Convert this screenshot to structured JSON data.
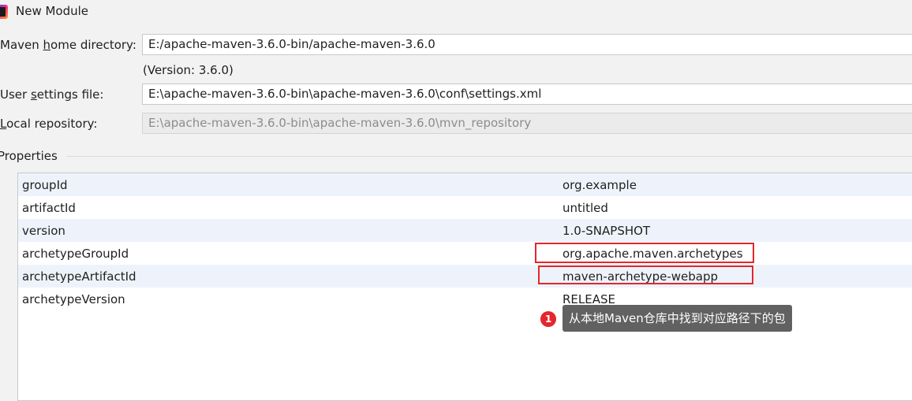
{
  "window": {
    "title": "New Module",
    "icon": "intellij-app-icon"
  },
  "form": {
    "maven_home": {
      "label_pre": "Maven ",
      "label_mnemonic": "h",
      "label_post": "ome directory:",
      "value": "E:/apache-maven-3.6.0-bin/apache-maven-3.6.0"
    },
    "version_note": "(Version: 3.6.0)",
    "user_settings": {
      "label_pre": "User ",
      "label_mnemonic": "s",
      "label_post": "ettings file:",
      "value": "E:\\apache-maven-3.6.0-bin\\apache-maven-3.6.0\\conf\\settings.xml"
    },
    "local_repo": {
      "label_pre": "",
      "label_mnemonic": "L",
      "label_post": "ocal repository:",
      "value": "E:\\apache-maven-3.6.0-bin\\apache-maven-3.6.0\\mvn_repository"
    }
  },
  "properties": {
    "section_label": "Properties",
    "rows": [
      {
        "key": "groupId",
        "value": "org.example"
      },
      {
        "key": "artifactId",
        "value": "untitled"
      },
      {
        "key": "version",
        "value": "1.0-SNAPSHOT"
      },
      {
        "key": "archetypeGroupId",
        "value": "org.apache.maven.archetypes"
      },
      {
        "key": "archetypeArtifactId",
        "value": "maven-archetype-webapp"
      },
      {
        "key": "archetypeVersion",
        "value": "RELEASE"
      }
    ]
  },
  "annotation": {
    "badge": "1",
    "text": "从本地Maven仓库中找到对应路径下的包",
    "highlight_color": "#e4262d"
  }
}
